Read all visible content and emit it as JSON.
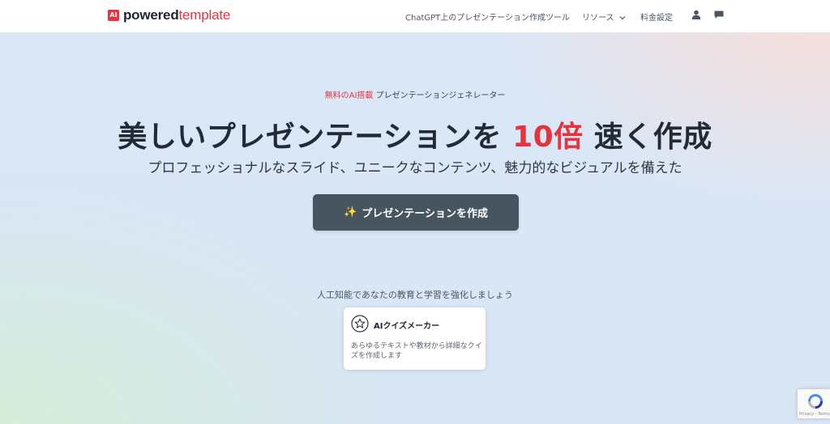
{
  "brand": {
    "mark": "AI",
    "name_bold": "powered",
    "name_light": "template"
  },
  "nav": {
    "link_tool": "ChatGPT上のプレゼンテーション作成ツール",
    "link_resources": "リソース",
    "link_pricing": "料金設定"
  },
  "hero": {
    "eyebrow_accent": "無料のAI搭載",
    "eyebrow_rest": " プレゼンテーションジェネレーター",
    "headline_pre": "美しいプレゼンテーションを ",
    "headline_accent": "10倍",
    "headline_post": " 速く作成",
    "subhead": "プロフェッショナルなスライド、ユニークなコンテンツ、魅力的なビジュアルを備えた",
    "cta_icon": "✨",
    "cta_label": "プレゼンテーションを作成"
  },
  "tools": {
    "caption": "人工知能であなたの教育と学習を強化しましょう",
    "card_title": "AIクイズメーカー",
    "card_desc": "あらゆるテキストや教材から詳細なクイズを作成します"
  },
  "recaptcha": {
    "footer": "Privacy - Terms"
  },
  "colors": {
    "accent": "#e5343c",
    "cta_bg": "#475560"
  }
}
